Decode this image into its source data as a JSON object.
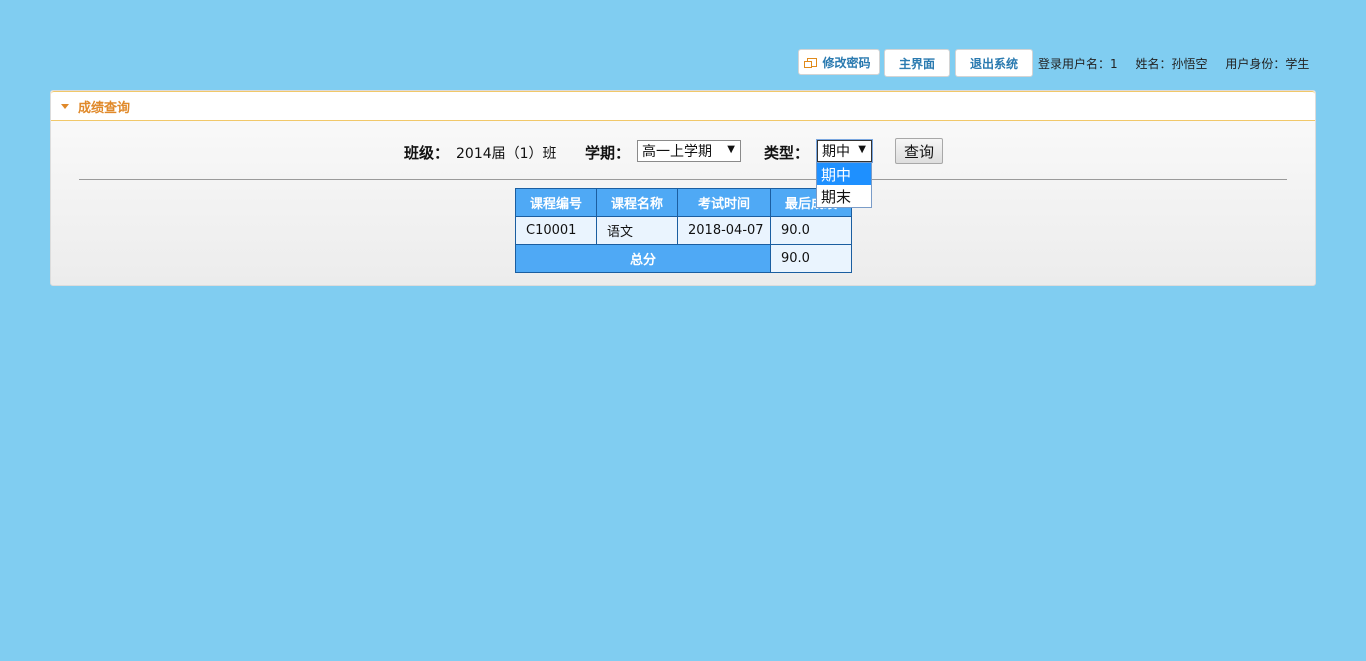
{
  "topbar": {
    "change_password": "修改密码",
    "home": "主界面",
    "logout": "退出系统",
    "login_user": "登录用户名：1",
    "name": "姓名：孙悟空",
    "identity": "用户身份：学生"
  },
  "panel": {
    "title": "成绩查询"
  },
  "filters": {
    "class_label": "班级：",
    "class_value": "2014届（1）班",
    "term_label": "学期：",
    "term_value": "高一上学期",
    "type_label": "类型：",
    "type_value": "期中",
    "query_button": "查询",
    "type_options": [
      "期中",
      "期末"
    ]
  },
  "table": {
    "headers": [
      "课程编号",
      "课程名称",
      "考试时间",
      "最后成绩"
    ],
    "rows": [
      [
        "C10001",
        "语文",
        "2018-04-07",
        "90.0"
      ]
    ],
    "total_label": "总分",
    "total_value": "90.0"
  },
  "colors": {
    "background": "#80cdf1",
    "header_blue": "#4fa9f5",
    "accent_orange": "#e0892a",
    "selected_option": "#1e90ff"
  }
}
